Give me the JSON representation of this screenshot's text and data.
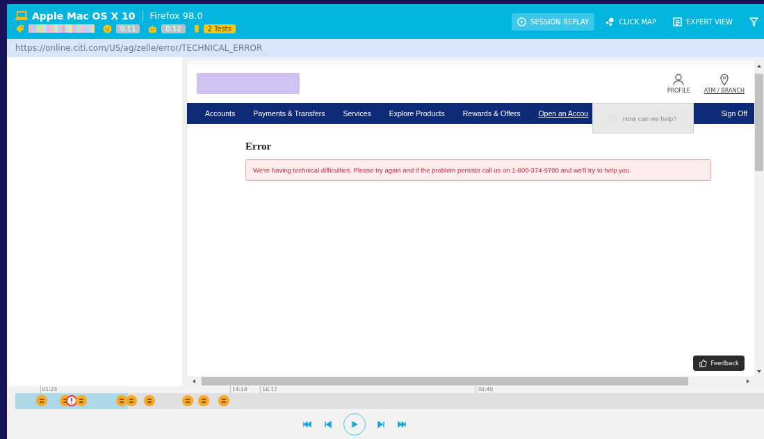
{
  "session": {
    "os": "Apple Mac OS X 10",
    "browser": "Firefox 98.0",
    "frustration_score": "0.11",
    "bot_score": "0.12",
    "tests": "2 Tests"
  },
  "views": [
    {
      "label": "SESSION REPLAY",
      "kind": "replay",
      "selected": true
    },
    {
      "label": "CLICK MAP",
      "kind": "clickmap",
      "selected": false
    },
    {
      "label": "EXPERT VIEW",
      "kind": "expert",
      "selected": false
    },
    {
      "kind": "filter",
      "selected": false
    }
  ],
  "url": "https://online.citi.com/US/ag/zelle/error/TECHNICAL_ERROR",
  "page": {
    "utility": [
      {
        "label": "PROFILE",
        "kind": "profile"
      },
      {
        "label": "ATM / BRANCH",
        "kind": "pin"
      }
    ],
    "nav": [
      {
        "label": "Accounts",
        "kind": "plain"
      },
      {
        "label": "Payments & Transfers",
        "kind": "plain"
      },
      {
        "label": "Services",
        "kind": "plain"
      },
      {
        "label": "Explore Products",
        "kind": "plain"
      },
      {
        "label": "Rewards & Offers",
        "kind": "plain"
      },
      {
        "label": "Open an Accou",
        "kind": "underlined"
      }
    ],
    "sign_off": "Sign Off",
    "search": {
      "placeholder": "How can we help?"
    },
    "heading": "Error",
    "alert": "We're having technical difficulties. Please try again and if the problem persists call us on 1-800-374-9700 and we'll try to help you.",
    "feedback": "Feedback"
  },
  "timeline": {
    "level": 0.15,
    "times": [
      "01:23",
      "14:14",
      "16:17",
      "30:40"
    ],
    "markers": [
      {
        "kind": "event"
      },
      {
        "kind": "event"
      },
      {
        "kind": "error"
      },
      {
        "kind": "event"
      },
      {
        "kind": "event"
      },
      {
        "kind": "event"
      },
      {
        "kind": "event"
      },
      {
        "kind": "event"
      },
      {
        "kind": "event"
      },
      {
        "kind": "event"
      }
    ]
  }
}
